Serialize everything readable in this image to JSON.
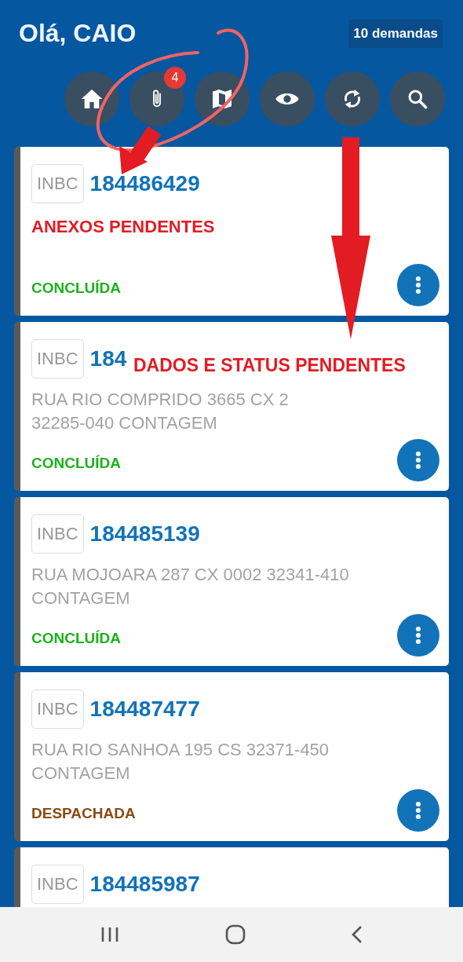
{
  "header": {
    "greeting": "Olá, CAIO",
    "count_badge": "10 demandas"
  },
  "toolbar": [
    {
      "kind": "home"
    },
    {
      "kind": "attachment",
      "badge": "4"
    },
    {
      "kind": "map"
    },
    {
      "kind": "eye"
    },
    {
      "kind": "sync"
    },
    {
      "kind": "search"
    }
  ],
  "orders": [
    {
      "tag": "INBC",
      "number": "184486429",
      "status": "CONCLUÍDA",
      "color": "#1db11d"
    },
    {
      "tag": "INBC",
      "number": "184",
      "address_lines": [
        "RUA RIO COMPRIDO 3665 CX 2",
        "32285-040 CONTAGEM"
      ],
      "status": "CONCLUÍDA",
      "color": "#1db11d"
    },
    {
      "tag": "INBC",
      "number": "184485139",
      "address_lines": [
        "RUA MOJOARA 287 CX 0002 32341-410",
        "CONTAGEM"
      ],
      "status": "CONCLUÍDA",
      "color": "#1db11d"
    },
    {
      "tag": "INBC",
      "number": "184487477",
      "address_lines": [
        "RUA RIO SANHOA 195 CS 32371-450",
        "CONTAGEM"
      ],
      "status": "DESPACHADA",
      "color": "#8a4b12"
    },
    {
      "tag": "INBC",
      "number": "184485987"
    }
  ],
  "annotations": [
    {
      "text": "ANEXOS PENDENTES"
    },
    {
      "text": "DADOS E STATUS PENDENTES"
    }
  ]
}
